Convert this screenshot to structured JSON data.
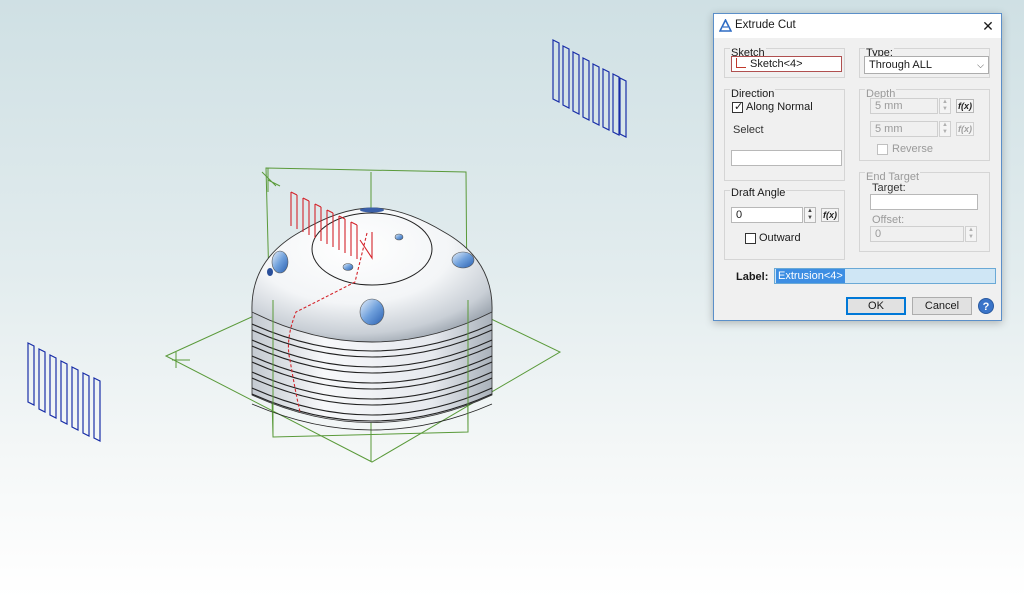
{
  "window": {
    "title": "Extrude Cut"
  },
  "sketch": {
    "label": "Sketch",
    "value": "Sketch<4>"
  },
  "type": {
    "label": "Type:",
    "value": "Through ALL"
  },
  "direction": {
    "label": "Direction",
    "along_normal": "Along Normal",
    "select_label": "Select"
  },
  "depth": {
    "label": "Depth",
    "value1": "5 mm",
    "value2": "5 mm",
    "reverse": "Reverse"
  },
  "draft": {
    "label": "Draft Angle",
    "value": "0",
    "outward": "Outward"
  },
  "end_target": {
    "label": "End Target",
    "target_label": "Target:",
    "offset_label": "Offset:",
    "offset_value": "0"
  },
  "label_row": {
    "label": "Label:",
    "value": "Extrusion<4>"
  },
  "buttons": {
    "ok": "OK",
    "cancel": "Cancel",
    "help": "?"
  },
  "icons": {
    "fx": "f(x)",
    "spin_up": "▲",
    "spin_down": "▼",
    "close": "✕",
    "check": "✓",
    "combo_arrow": "⌵"
  },
  "colors": {
    "accent": "#0078d7",
    "sketch_red": "#d4242b",
    "wire_green": "#5a9a3a",
    "plane_blue": "#1a2fa8"
  }
}
